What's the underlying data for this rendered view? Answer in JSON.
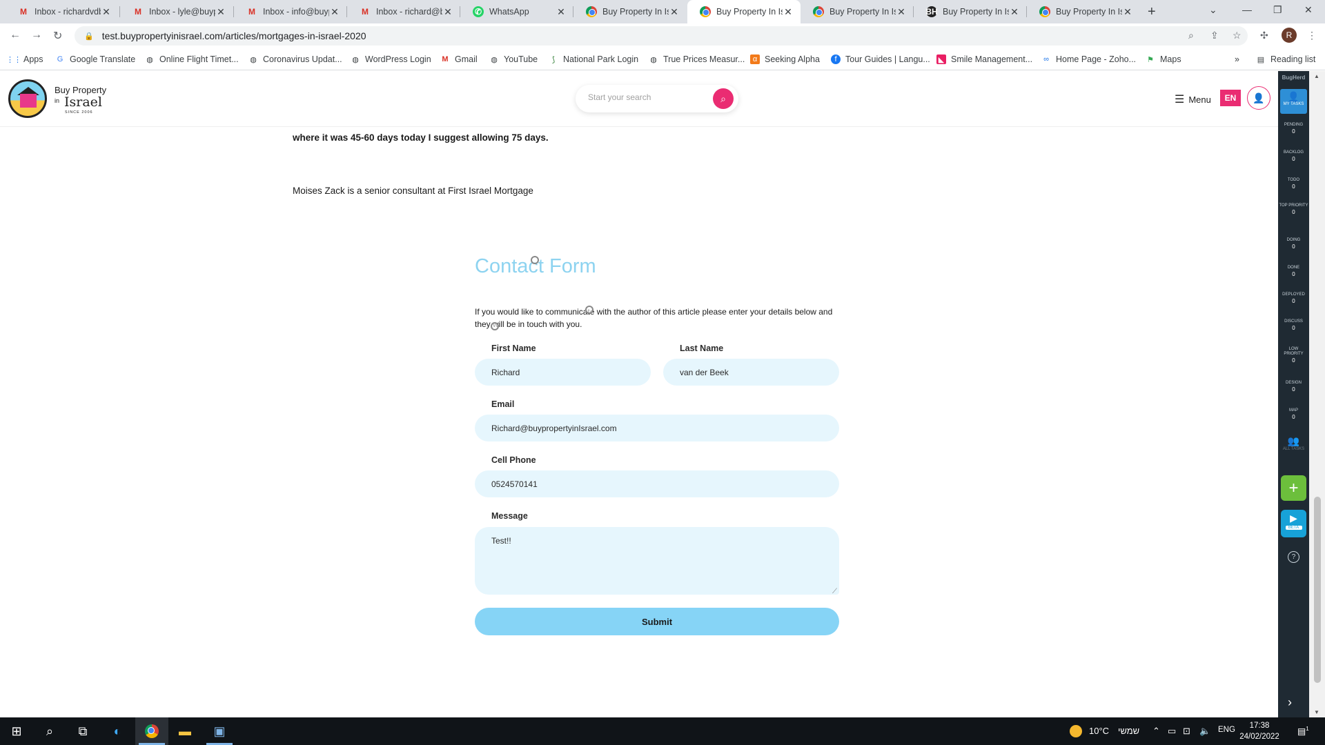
{
  "browser": {
    "tabs": [
      {
        "title": "Inbox - richardvdb",
        "icon": "gmail-icon"
      },
      {
        "title": "Inbox - lyle@buyp",
        "icon": "gmail-icon"
      },
      {
        "title": "Inbox - info@buyp",
        "icon": "gmail-icon"
      },
      {
        "title": "Inbox - richard@b",
        "icon": "gmail-icon"
      },
      {
        "title": "WhatsApp",
        "icon": "whatsapp-icon"
      },
      {
        "title": "Buy Property In Isr",
        "icon": "chrome-icon"
      },
      {
        "title": "Buy Property In Isr",
        "icon": "chrome-icon",
        "active": true
      },
      {
        "title": "Buy Property In Isr",
        "icon": "chrome-icon"
      },
      {
        "title": "Buy Property In Isr",
        "icon": "bugherd-icon"
      },
      {
        "title": "Buy Property In Isr",
        "icon": "chrome-icon"
      }
    ],
    "url": "test.buypropertyinisrael.com/articles/mortgages-in-israel-2020",
    "profile_initial": "R",
    "bookmarks": [
      {
        "label": "Apps",
        "icon": "apps-grid-icon"
      },
      {
        "label": "Google Translate",
        "icon": "translate-icon"
      },
      {
        "label": "Online Flight Timet...",
        "icon": "globe-icon"
      },
      {
        "label": "Coronavirus Updat...",
        "icon": "globe-icon"
      },
      {
        "label": "WordPress Login",
        "icon": "globe-icon"
      },
      {
        "label": "Gmail",
        "icon": "gmail-icon"
      },
      {
        "label": "YouTube",
        "icon": "globe-icon"
      },
      {
        "label": "National Park Login",
        "icon": "leaf-icon"
      },
      {
        "label": "True Prices Measur...",
        "icon": "globe-icon"
      },
      {
        "label": "Seeking Alpha",
        "icon": "alpha-icon"
      },
      {
        "label": "Tour Guides | Langu...",
        "icon": "facebook-icon"
      },
      {
        "label": "Smile Management...",
        "icon": "smile-icon"
      },
      {
        "label": "Home Page - Zoho...",
        "icon": "zoho-icon"
      },
      {
        "label": "Maps",
        "icon": "maps-icon"
      }
    ],
    "reading_list": "Reading list",
    "more_bookmarks": "»"
  },
  "site": {
    "logo_line1": "Buy Property",
    "logo_in": "in",
    "logo_line2": "Israel",
    "logo_since": "SINCE 2006",
    "search_placeholder": "Start your search",
    "menu_label": "Menu",
    "lang": "EN"
  },
  "article": {
    "line1": "where it was 45-60 days today I suggest allowing 75 days.",
    "line2": "Moises Zack is a senior consultant at First Israel Mortgage"
  },
  "contact_form": {
    "title": "Contact Form",
    "intro": "If you would like to communicate with the author of this article please enter your details below and they will be in touch with you.",
    "first_name_label": "First Name",
    "first_name_value": "Richard",
    "last_name_label": "Last Name",
    "last_name_value": "van der Beek",
    "email_label": "Email",
    "email_value": "Richard@buypropertyinIsrael.com",
    "phone_label": "Cell Phone",
    "phone_value": "0524570141",
    "message_label": "Message",
    "message_value": "Test!!",
    "submit_label": "Submit"
  },
  "bugherd": {
    "logo": "BugHerd",
    "my_tasks": "MY TASKS",
    "columns": [
      {
        "label": "PENDING",
        "count": "0"
      },
      {
        "label": "BACKLOG",
        "count": "0"
      },
      {
        "label": "TODO",
        "count": "0"
      },
      {
        "label": "TOP PRIORITY",
        "count": "0"
      },
      {
        "label": "DOING",
        "count": "0"
      },
      {
        "label": "DONE",
        "count": "0"
      },
      {
        "label": "DEPLOYED",
        "count": "0"
      },
      {
        "label": "DISCUSS",
        "count": "0"
      },
      {
        "label": "LOW PRIORITY",
        "count": "0"
      },
      {
        "label": "DESIGN",
        "count": "0"
      },
      {
        "label": "MAP",
        "count": "0"
      }
    ],
    "all_tasks": "ALL TASKS",
    "beta": "BETA"
  },
  "taskbar": {
    "temperature": "10°C",
    "weather_text": "שמשי",
    "language": "ENG",
    "time": "17:38",
    "date": "24/02/2022",
    "notifications": "1"
  },
  "colors": {
    "brand_pink": "#ea2c72",
    "form_title": "#8dd3f0",
    "field_bg": "#e6f6fd",
    "submit_bg": "#86d4f6",
    "bugherd_bg": "#1f2a33"
  }
}
